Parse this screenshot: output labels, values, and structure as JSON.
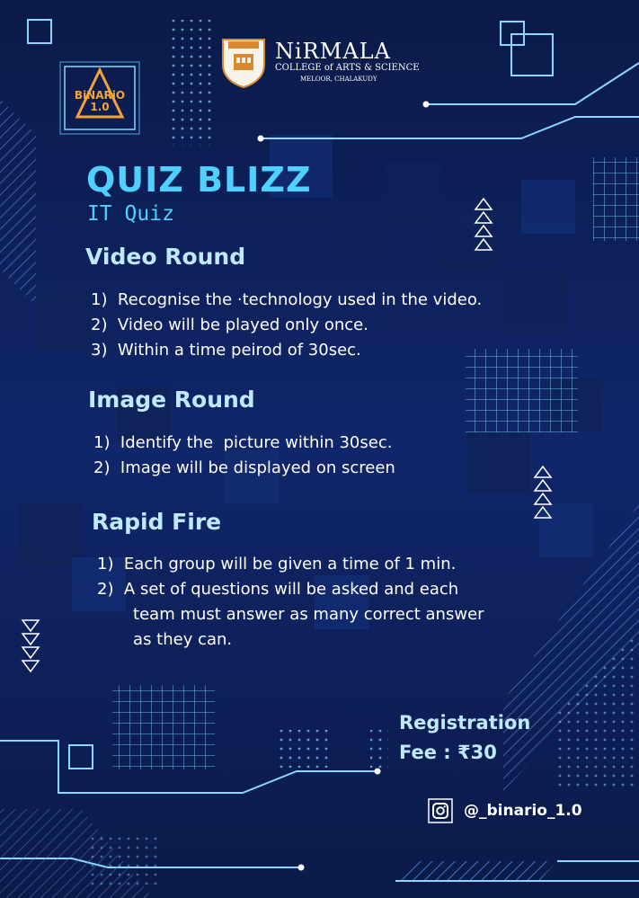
{
  "header": {
    "event_logo_text": "BiNARiO 1.0",
    "college_name": "NiRMALA",
    "college_subtitle": "COLLEGE of ARTS & SCIENCE",
    "college_location": "MELOOR, CHALAKUDY"
  },
  "event": {
    "title": "QUIZ BLIZZ",
    "subtitle": "IT Quiz"
  },
  "rounds": [
    {
      "heading": "Video Round",
      "rules": [
        "1)  Recognise the ·technology used in the video.",
        "2)  Video will be played only once.",
        "3)  Within a time peirod of 30sec."
      ]
    },
    {
      "heading": "Image Round",
      "rules": [
        "1)  Identify the  picture within 30sec.",
        "2)  Image will be displayed on screen"
      ]
    },
    {
      "heading": "Rapid Fire",
      "rules": [
        "1)  Each group will be given a time of 1 min.",
        "2)  A set of questions will be asked and each",
        "       team must answer as many correct answer",
        "       as they can."
      ]
    }
  ],
  "registration": {
    "line1": "Registration",
    "line2": "Fee : ₹30"
  },
  "social": {
    "icon": "instagram-icon",
    "handle": "@_binario_1.0"
  },
  "colors": {
    "background": "#0d1f52",
    "accent": "#4fd0ff",
    "heading": "#bfe9ff",
    "logo_orange": "#f2a33a"
  }
}
